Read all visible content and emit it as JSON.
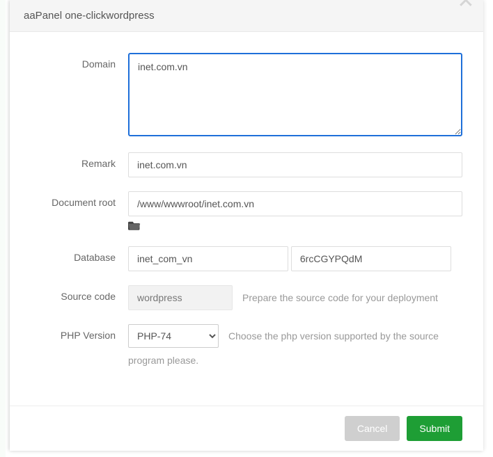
{
  "title": "aaPanel one-clickwordpress",
  "form": {
    "domain": {
      "label": "Domain",
      "value": "inet.com.vn"
    },
    "remark": {
      "label": "Remark",
      "value": "inet.com.vn"
    },
    "docroot": {
      "label": "Document root",
      "value": "/www/wwwroot/inet.com.vn"
    },
    "database": {
      "label": "Database",
      "name": "inet_com_vn",
      "password": "6rcCGYPQdM"
    },
    "source": {
      "label": "Source code",
      "value": "wordpress",
      "hint": "Prepare the source code for your deployment"
    },
    "php": {
      "label": "PHP Version",
      "selected": "PHP-74",
      "options": [
        "PHP-74"
      ],
      "hint_line1": "Choose the php version supported by the source",
      "hint_line2": "program please."
    }
  },
  "buttons": {
    "cancel": "Cancel",
    "submit": "Submit"
  }
}
